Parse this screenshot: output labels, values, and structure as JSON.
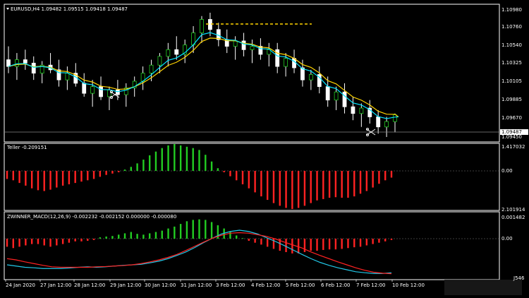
{
  "chart_info": {
    "symbol_line": "EURUSD,H4  1.09482 1.09515 1.09418 1.09487",
    "current_price": "1.09487",
    "current_price_partial": "1.09450"
  },
  "colors": {
    "background": "#000000",
    "frame": "#ffffff",
    "bull_candle": "#ffffff",
    "bear_candle": "#ffffff",
    "ma_fast": "#00e5ff",
    "ma_slow": "#ffd400",
    "dotted_level": "#ffd400",
    "hist_up": "#22cc22",
    "hist_down": "#ff2222",
    "macd_line": "#22c8e8",
    "signal_line": "#ff2222",
    "zero_line": "#888888"
  },
  "price_axis": [
    "1.10980",
    "1.10760",
    "1.10540",
    "1.10325",
    "1.10105",
    "1.09885",
    "1.09670"
  ],
  "teller_pane": {
    "title": "Teller -0.209151",
    "axis_top": "1.417032",
    "axis_zero": "0.00",
    "axis_bottom": "2.101914",
    "values": [
      -0.3,
      -0.35,
      -0.45,
      -0.55,
      -0.65,
      -0.72,
      -0.75,
      -0.7,
      -0.62,
      -0.55,
      -0.5,
      -0.45,
      -0.4,
      -0.35,
      -0.3,
      -0.22,
      -0.15,
      -0.1,
      -0.05,
      0.05,
      0.15,
      0.28,
      0.42,
      0.58,
      0.72,
      0.85,
      0.95,
      1.0,
      0.95,
      0.9,
      0.85,
      0.78,
      0.6,
      0.35,
      0.1,
      -0.05,
      -0.2,
      -0.35,
      -0.5,
      -0.65,
      -0.8,
      -0.95,
      -1.08,
      -1.2,
      -1.3,
      -1.38,
      -1.42,
      -1.38,
      -1.3,
      -1.2,
      -1.1,
      -1.05,
      -1.0,
      -0.98,
      -1.0,
      -1.0,
      -0.95,
      -0.85,
      -0.75,
      -0.62,
      -0.48,
      -0.35,
      -0.25
    ]
  },
  "macd_pane": {
    "title": "ZWINNER_MACD(12,26,9) -0.002232 -0.002152 0.000000 -0.000080",
    "axis_top": "0.001482",
    "axis_zero": "0.00",
    "hist": [
      -0.3,
      -0.35,
      -0.3,
      -0.25,
      -0.2,
      -0.2,
      -0.25,
      -0.3,
      -0.25,
      -0.2,
      -0.15,
      -0.1,
      -0.1,
      -0.08,
      -0.05,
      0.05,
      0.08,
      0.1,
      0.15,
      0.2,
      0.25,
      0.18,
      0.15,
      0.2,
      0.25,
      0.3,
      0.38,
      0.45,
      0.55,
      0.65,
      0.7,
      0.72,
      0.7,
      0.62,
      0.5,
      0.38,
      0.25,
      0.12,
      0.02,
      -0.08,
      -0.15,
      -0.22,
      -0.3,
      -0.38,
      -0.45,
      -0.5,
      -0.55,
      -0.55,
      -0.5,
      -0.45,
      -0.45,
      -0.42,
      -0.4,
      -0.4,
      -0.38,
      -0.35,
      -0.32,
      -0.3,
      -0.25,
      -0.2,
      -0.15,
      -0.1,
      -0.05
    ],
    "macd_line": [
      -0.8,
      -0.85,
      -0.9,
      -0.92,
      -0.95,
      -0.95,
      -0.95,
      -0.93,
      -0.9,
      -0.88,
      -0.9,
      -0.88,
      -0.85,
      -0.82,
      -0.8,
      -0.78,
      -0.72,
      -0.65,
      -0.55,
      -0.42,
      -0.28,
      -0.1,
      0.1,
      0.28,
      0.45,
      0.55,
      0.6,
      0.55,
      0.45,
      0.3,
      0.15,
      -0.02,
      -0.2,
      -0.38,
      -0.55,
      -0.7,
      -0.82,
      -0.92,
      -1.0,
      -1.08,
      -1.12,
      -1.15,
      -1.15,
      -1.12
    ],
    "signal_line": [
      -0.55,
      -0.6,
      -0.68,
      -0.75,
      -0.82,
      -0.88,
      -0.9,
      -0.9,
      -0.9,
      -0.9,
      -0.88,
      -0.87,
      -0.85,
      -0.83,
      -0.8,
      -0.75,
      -0.68,
      -0.6,
      -0.5,
      -0.38,
      -0.22,
      -0.05,
      0.12,
      0.28,
      0.4,
      0.48,
      0.5,
      0.48,
      0.42,
      0.35,
      0.25,
      0.12,
      0,
      -0.12,
      -0.28,
      -0.42,
      -0.55,
      -0.68,
      -0.8,
      -0.92,
      -1.02,
      -1.1,
      -1.14,
      -1.16
    ]
  },
  "time_axis": [
    "24 Jan 2020",
    "27 Jan 12:00",
    "28 Jan 12:00",
    "29 Jan 12:00",
    "30 Jan 12:00",
    "31 Jan 12:00",
    "3 Feb 12:00",
    "4 Feb 12:00",
    "5 Feb 12:00",
    "6 Feb 12:00",
    "7 Feb 12:00",
    "10 Feb 12:00"
  ],
  "corner_text": "J546",
  "candles": [
    {
      "o": 1.103,
      "h": 1.105,
      "l": 1.101,
      "c": 1.102
    },
    {
      "o": 1.102,
      "h": 1.104,
      "l": 1.1,
      "c": 1.103
    },
    {
      "o": 1.103,
      "h": 1.1045,
      "l": 1.1015,
      "c": 1.1025
    },
    {
      "o": 1.1025,
      "h": 1.1035,
      "l": 1.1,
      "c": 1.101
    },
    {
      "o": 1.101,
      "h": 1.1028,
      "l": 1.0995,
      "c": 1.1022
    },
    {
      "o": 1.1022,
      "h": 1.104,
      "l": 1.101,
      "c": 1.1015
    },
    {
      "o": 1.1015,
      "h": 1.103,
      "l": 1.099,
      "c": 1.1
    },
    {
      "o": 1.1,
      "h": 1.102,
      "l": 1.0985,
      "c": 1.101
    },
    {
      "o": 1.101,
      "h": 1.1025,
      "l": 1.099,
      "c": 1.0995
    },
    {
      "o": 1.0995,
      "h": 1.101,
      "l": 1.0975,
      "c": 1.098
    },
    {
      "o": 1.098,
      "h": 1.1,
      "l": 1.096,
      "c": 1.099
    },
    {
      "o": 1.099,
      "h": 1.1005,
      "l": 1.097,
      "c": 1.0975
    },
    {
      "o": 1.0975,
      "h": 1.099,
      "l": 1.0955,
      "c": 1.0985
    },
    {
      "o": 1.0985,
      "h": 1.1,
      "l": 1.097,
      "c": 1.0978
    },
    {
      "o": 1.0978,
      "h": 1.0995,
      "l": 1.096,
      "c": 1.0988
    },
    {
      "o": 1.0988,
      "h": 1.1005,
      "l": 1.0975,
      "c": 1.0998
    },
    {
      "o": 1.0998,
      "h": 1.102,
      "l": 1.0985,
      "c": 1.101
    },
    {
      "o": 1.101,
      "h": 1.103,
      "l": 1.0998,
      "c": 1.1022
    },
    {
      "o": 1.1022,
      "h": 1.104,
      "l": 1.101,
      "c": 1.1035
    },
    {
      "o": 1.1035,
      "h": 1.1055,
      "l": 1.102,
      "c": 1.1045
    },
    {
      "o": 1.1045,
      "h": 1.1065,
      "l": 1.103,
      "c": 1.1038
    },
    {
      "o": 1.1038,
      "h": 1.106,
      "l": 1.1025,
      "c": 1.1052
    },
    {
      "o": 1.1052,
      "h": 1.108,
      "l": 1.104,
      "c": 1.107
    },
    {
      "o": 1.107,
      "h": 1.1095,
      "l": 1.1055,
      "c": 1.109
    },
    {
      "o": 1.109,
      "h": 1.11,
      "l": 1.1065,
      "c": 1.1075
    },
    {
      "o": 1.1075,
      "h": 1.1085,
      "l": 1.105,
      "c": 1.106
    },
    {
      "o": 1.106,
      "h": 1.1075,
      "l": 1.104,
      "c": 1.105
    },
    {
      "o": 1.105,
      "h": 1.1065,
      "l": 1.103,
      "c": 1.1058
    },
    {
      "o": 1.1058,
      "h": 1.107,
      "l": 1.1035,
      "c": 1.1045
    },
    {
      "o": 1.1045,
      "h": 1.106,
      "l": 1.1025,
      "c": 1.105
    },
    {
      "o": 1.105,
      "h": 1.1062,
      "l": 1.103,
      "c": 1.1038
    },
    {
      "o": 1.1038,
      "h": 1.1055,
      "l": 1.102,
      "c": 1.1045
    },
    {
      "o": 1.1045,
      "h": 1.1055,
      "l": 1.101,
      "c": 1.102
    },
    {
      "o": 1.102,
      "h": 1.104,
      "l": 1.1005,
      "c": 1.1032
    },
    {
      "o": 1.1032,
      "h": 1.1045,
      "l": 1.101,
      "c": 1.1018
    },
    {
      "o": 1.1018,
      "h": 1.103,
      "l": 1.099,
      "c": 1.1
    },
    {
      "o": 1.1,
      "h": 1.1015,
      "l": 1.0985,
      "c": 1.1008
    },
    {
      "o": 1.1008,
      "h": 1.102,
      "l": 1.098,
      "c": 1.099
    },
    {
      "o": 1.099,
      "h": 1.1005,
      "l": 1.096,
      "c": 1.097
    },
    {
      "o": 1.097,
      "h": 1.099,
      "l": 1.0955,
      "c": 1.0982
    },
    {
      "o": 1.0982,
      "h": 1.0995,
      "l": 1.095,
      "c": 1.096
    },
    {
      "o": 1.096,
      "h": 1.0975,
      "l": 1.094,
      "c": 1.095
    },
    {
      "o": 1.095,
      "h": 1.0965,
      "l": 1.093,
      "c": 1.0958
    },
    {
      "o": 1.0958,
      "h": 1.097,
      "l": 1.0935,
      "c": 1.0945
    },
    {
      "o": 1.0945,
      "h": 1.0955,
      "l": 1.092,
      "c": 1.093
    },
    {
      "o": 1.093,
      "h": 1.0945,
      "l": 1.0915,
      "c": 1.0938
    },
    {
      "o": 1.0938,
      "h": 1.095,
      "l": 1.0922,
      "c": 1.0948
    }
  ]
}
